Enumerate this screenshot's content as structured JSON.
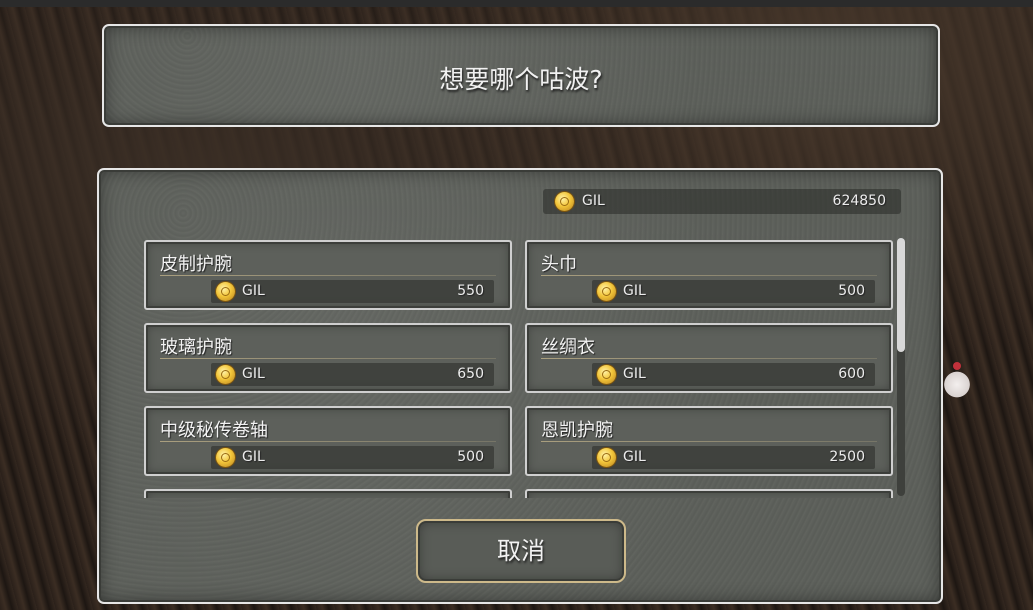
{
  "prompt": {
    "title": "想要哪个咕波?"
  },
  "wallet": {
    "currency": "GIL",
    "amount": "624850"
  },
  "items": [
    {
      "name": "皮制护腕",
      "currency": "GIL",
      "price": "550"
    },
    {
      "name": "头巾",
      "currency": "GIL",
      "price": "500"
    },
    {
      "name": "玻璃护腕",
      "currency": "GIL",
      "price": "650"
    },
    {
      "name": "丝绸衣",
      "currency": "GIL",
      "price": "600"
    },
    {
      "name": "中级秘传卷轴",
      "currency": "GIL",
      "price": "500"
    },
    {
      "name": "恩凯护腕",
      "currency": "GIL",
      "price": "2500"
    }
  ],
  "cancel": {
    "label": "取消"
  },
  "colors": {
    "panel": "#5c5f5a",
    "border": "#e6e6e6",
    "coin": "#f3c63a",
    "cancel_border": "#cdb98a"
  }
}
